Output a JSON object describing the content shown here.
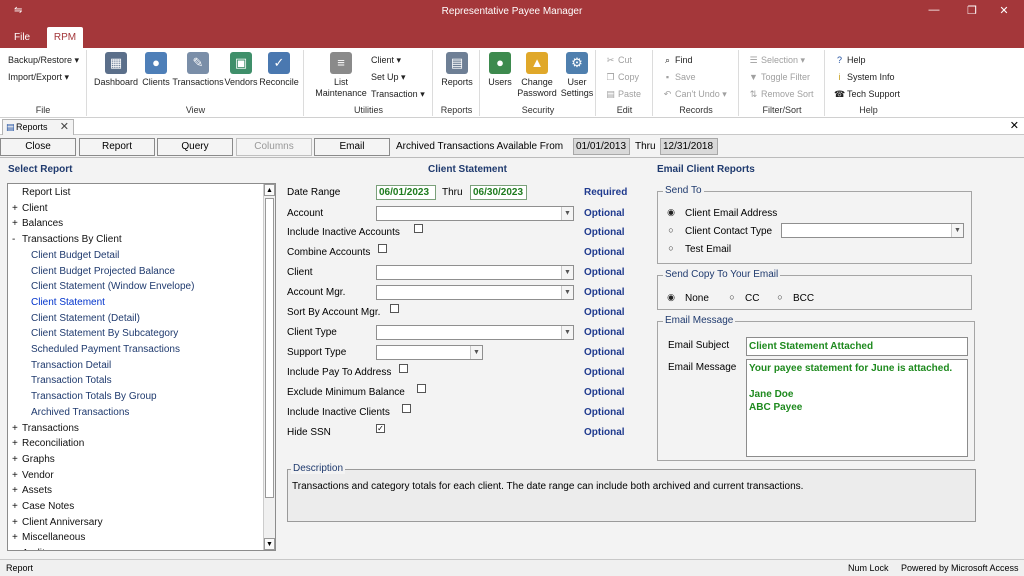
{
  "window": {
    "title": "Representative Payee Manager",
    "qat_icon": "⇋",
    "minimize": "—",
    "restore": "❐",
    "close": "✕"
  },
  "ribbon_tabs": [
    "File",
    "RPM"
  ],
  "ribbon": {
    "file": {
      "backup_restore": "Backup/Restore",
      "import_export": "Import/Export",
      "group": "File"
    },
    "view": {
      "dashboard": "Dashboard",
      "clients": "Clients",
      "transactions": "Transactions",
      "vendors": "Vendors",
      "reconcile": "Reconcile",
      "group": "View"
    },
    "utilities": {
      "list_maintenance_1": "List",
      "list_maintenance_2": "Maintenance",
      "client": "Client",
      "set_up": "Set Up",
      "transaction": "Transaction",
      "group": "Utilities"
    },
    "reports": {
      "reports": "Reports",
      "group": "Reports"
    },
    "security": {
      "users": "Users",
      "change_password_1": "Change",
      "change_password_2": "Password",
      "user_settings_1": "User",
      "user_settings_2": "Settings",
      "group": "Security"
    },
    "edit": {
      "cut": "Cut",
      "copy": "Copy",
      "paste": "Paste",
      "group": "Edit"
    },
    "records": {
      "find": "Find",
      "save": "Save",
      "cant_undo": "Can't Undo",
      "group": "Records"
    },
    "filter_sort": {
      "selection": "Selection",
      "toggle_filter": "Toggle Filter",
      "remove_sort": "Remove Sort",
      "group": "Filter/Sort"
    },
    "help": {
      "help": "Help",
      "system_info": "System Info",
      "tech_support": "Tech Support",
      "group": "Help"
    }
  },
  "doc_tab": {
    "label": "Reports"
  },
  "toolbar": {
    "close": "Close",
    "report": "Report",
    "query": "Query",
    "columns": "Columns",
    "email": "Email",
    "archived_label": "Archived Transactions Available From",
    "from": "01/01/2013",
    "thru_label": "Thru",
    "thru": "12/31/2018"
  },
  "select_report": {
    "title": "Select Report",
    "items": [
      {
        "pm": "",
        "label": "Report List",
        "level": 0
      },
      {
        "pm": "+",
        "label": "Client",
        "level": 0
      },
      {
        "pm": "+",
        "label": "Balances",
        "level": 0
      },
      {
        "pm": "-",
        "label": "Transactions By Client",
        "level": 0
      },
      {
        "pm": "",
        "label": "Client Budget Detail",
        "level": 1
      },
      {
        "pm": "",
        "label": "Client Budget Projected Balance",
        "level": 1
      },
      {
        "pm": "",
        "label": "Client Statement (Window Envelope)",
        "level": 1
      },
      {
        "pm": "",
        "label": "Client Statement",
        "level": 1,
        "selected": true
      },
      {
        "pm": "",
        "label": "Client Statement (Detail)",
        "level": 1
      },
      {
        "pm": "",
        "label": "Client Statement By Subcategory",
        "level": 1
      },
      {
        "pm": "",
        "label": "Scheduled Payment Transactions",
        "level": 1
      },
      {
        "pm": "",
        "label": "Transaction Detail",
        "level": 1
      },
      {
        "pm": "",
        "label": "Transaction Totals",
        "level": 1
      },
      {
        "pm": "",
        "label": "Transaction Totals By Group",
        "level": 1
      },
      {
        "pm": "",
        "label": "Archived Transactions",
        "level": 1
      },
      {
        "pm": "+",
        "label": "Transactions",
        "level": 0
      },
      {
        "pm": "+",
        "label": "Reconciliation",
        "level": 0
      },
      {
        "pm": "+",
        "label": "Graphs",
        "level": 0
      },
      {
        "pm": "+",
        "label": "Vendor",
        "level": 0
      },
      {
        "pm": "+",
        "label": "Assets",
        "level": 0
      },
      {
        "pm": "+",
        "label": "Case Notes",
        "level": 0
      },
      {
        "pm": "+",
        "label": "Client Anniversary",
        "level": 0
      },
      {
        "pm": "+",
        "label": "Miscellaneous",
        "level": 0
      },
      {
        "pm": "+",
        "label": "Audit",
        "level": 0
      }
    ]
  },
  "client_statement": {
    "title": "Client Statement",
    "date_range_label": "Date Range",
    "start_date": "06/01/2023",
    "thru_label": "Thru",
    "end_date": "06/30/2023",
    "required": "Required",
    "optional": "Optional",
    "account": "Account",
    "include_inactive_accounts": "Include Inactive Accounts",
    "combine_accounts": "Combine Accounts",
    "client": "Client",
    "account_mgr": "Account Mgr.",
    "sort_by_account_mgr": "Sort By Account Mgr.",
    "client_type": "Client Type",
    "support_type": "Support Type",
    "include_pay_to_address": "Include Pay To Address",
    "exclude_minimum_balance": "Exclude Minimum Balance",
    "include_inactive_clients": "Include Inactive Clients",
    "hide_ssn": "Hide SSN",
    "check_mark": "✓"
  },
  "description": {
    "legend": "Description",
    "text": "Transactions and category totals for each client. The date range can include both archived and current transactions."
  },
  "email_reports": {
    "title": "Email Client Reports",
    "send_to": {
      "legend": "Send To",
      "client_email": "Client Email Address",
      "client_contact_type": "Client Contact Type",
      "test_email": "Test Email"
    },
    "send_copy": {
      "legend": "Send Copy To Your Email",
      "none": "None",
      "cc": "CC",
      "bcc": "BCC"
    },
    "message": {
      "legend": "Email Message",
      "subject_label": "Email Subject",
      "subject": "Client Statement Attached",
      "message_label": "Email Message",
      "line1": "Your payee statement for June is attached.",
      "line2": "Jane Doe",
      "line3": "ABC Payee"
    }
  },
  "status": {
    "left": "Report",
    "num_lock": "Num Lock",
    "powered": "Powered by Microsoft Access"
  }
}
